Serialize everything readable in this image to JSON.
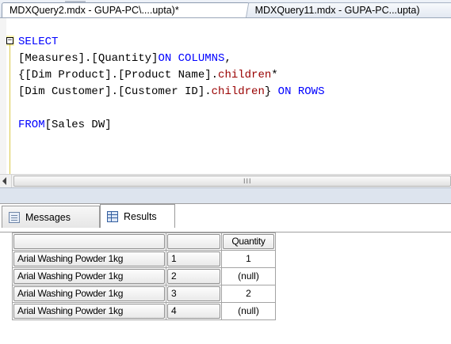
{
  "tabs": [
    {
      "label": "MDXQuery2.mdx - GUPA-PC\\....upta)*",
      "active": true
    },
    {
      "label": "MDXQuery11.mdx - GUPA-PC...upta)",
      "active": false
    }
  ],
  "editor": {
    "lines": [
      {
        "parts": [
          {
            "t": "SELECT",
            "c": "kw"
          }
        ]
      },
      {
        "parts": [
          {
            "t": "[Measures].[Quantity]",
            "c": ""
          },
          {
            "t": "ON COLUMNS",
            "c": "kw"
          },
          {
            "t": ",",
            "c": ""
          }
        ]
      },
      {
        "parts": [
          {
            "t": "{[Dim Product].[Product Name].",
            "c": ""
          },
          {
            "t": "children",
            "c": "fn"
          },
          {
            "t": "*",
            "c": ""
          }
        ]
      },
      {
        "parts": [
          {
            "t": "[Dim Customer].[Customer ID].",
            "c": ""
          },
          {
            "t": "children",
            "c": "fn"
          },
          {
            "t": "} ",
            "c": ""
          },
          {
            "t": "ON ROWS",
            "c": "kw"
          }
        ]
      },
      {
        "parts": [
          {
            "t": "",
            "c": ""
          }
        ]
      },
      {
        "parts": [
          {
            "t": "FROM",
            "c": "kw"
          },
          {
            "t": "[Sales DW]",
            "c": ""
          }
        ]
      }
    ],
    "scroll_grip": "III"
  },
  "results_tabs": {
    "messages": "Messages",
    "results": "Results"
  },
  "grid": {
    "header": [
      "",
      "",
      "Quantity"
    ],
    "rows": [
      [
        "Arial Washing Powder 1kg",
        "1",
        "1"
      ],
      [
        "Arial Washing Powder 1kg",
        "2",
        "(null)"
      ],
      [
        "Arial Washing Powder 1kg",
        "3",
        "2"
      ],
      [
        "Arial Washing Powder 1kg",
        "4",
        "(null)"
      ]
    ]
  }
}
